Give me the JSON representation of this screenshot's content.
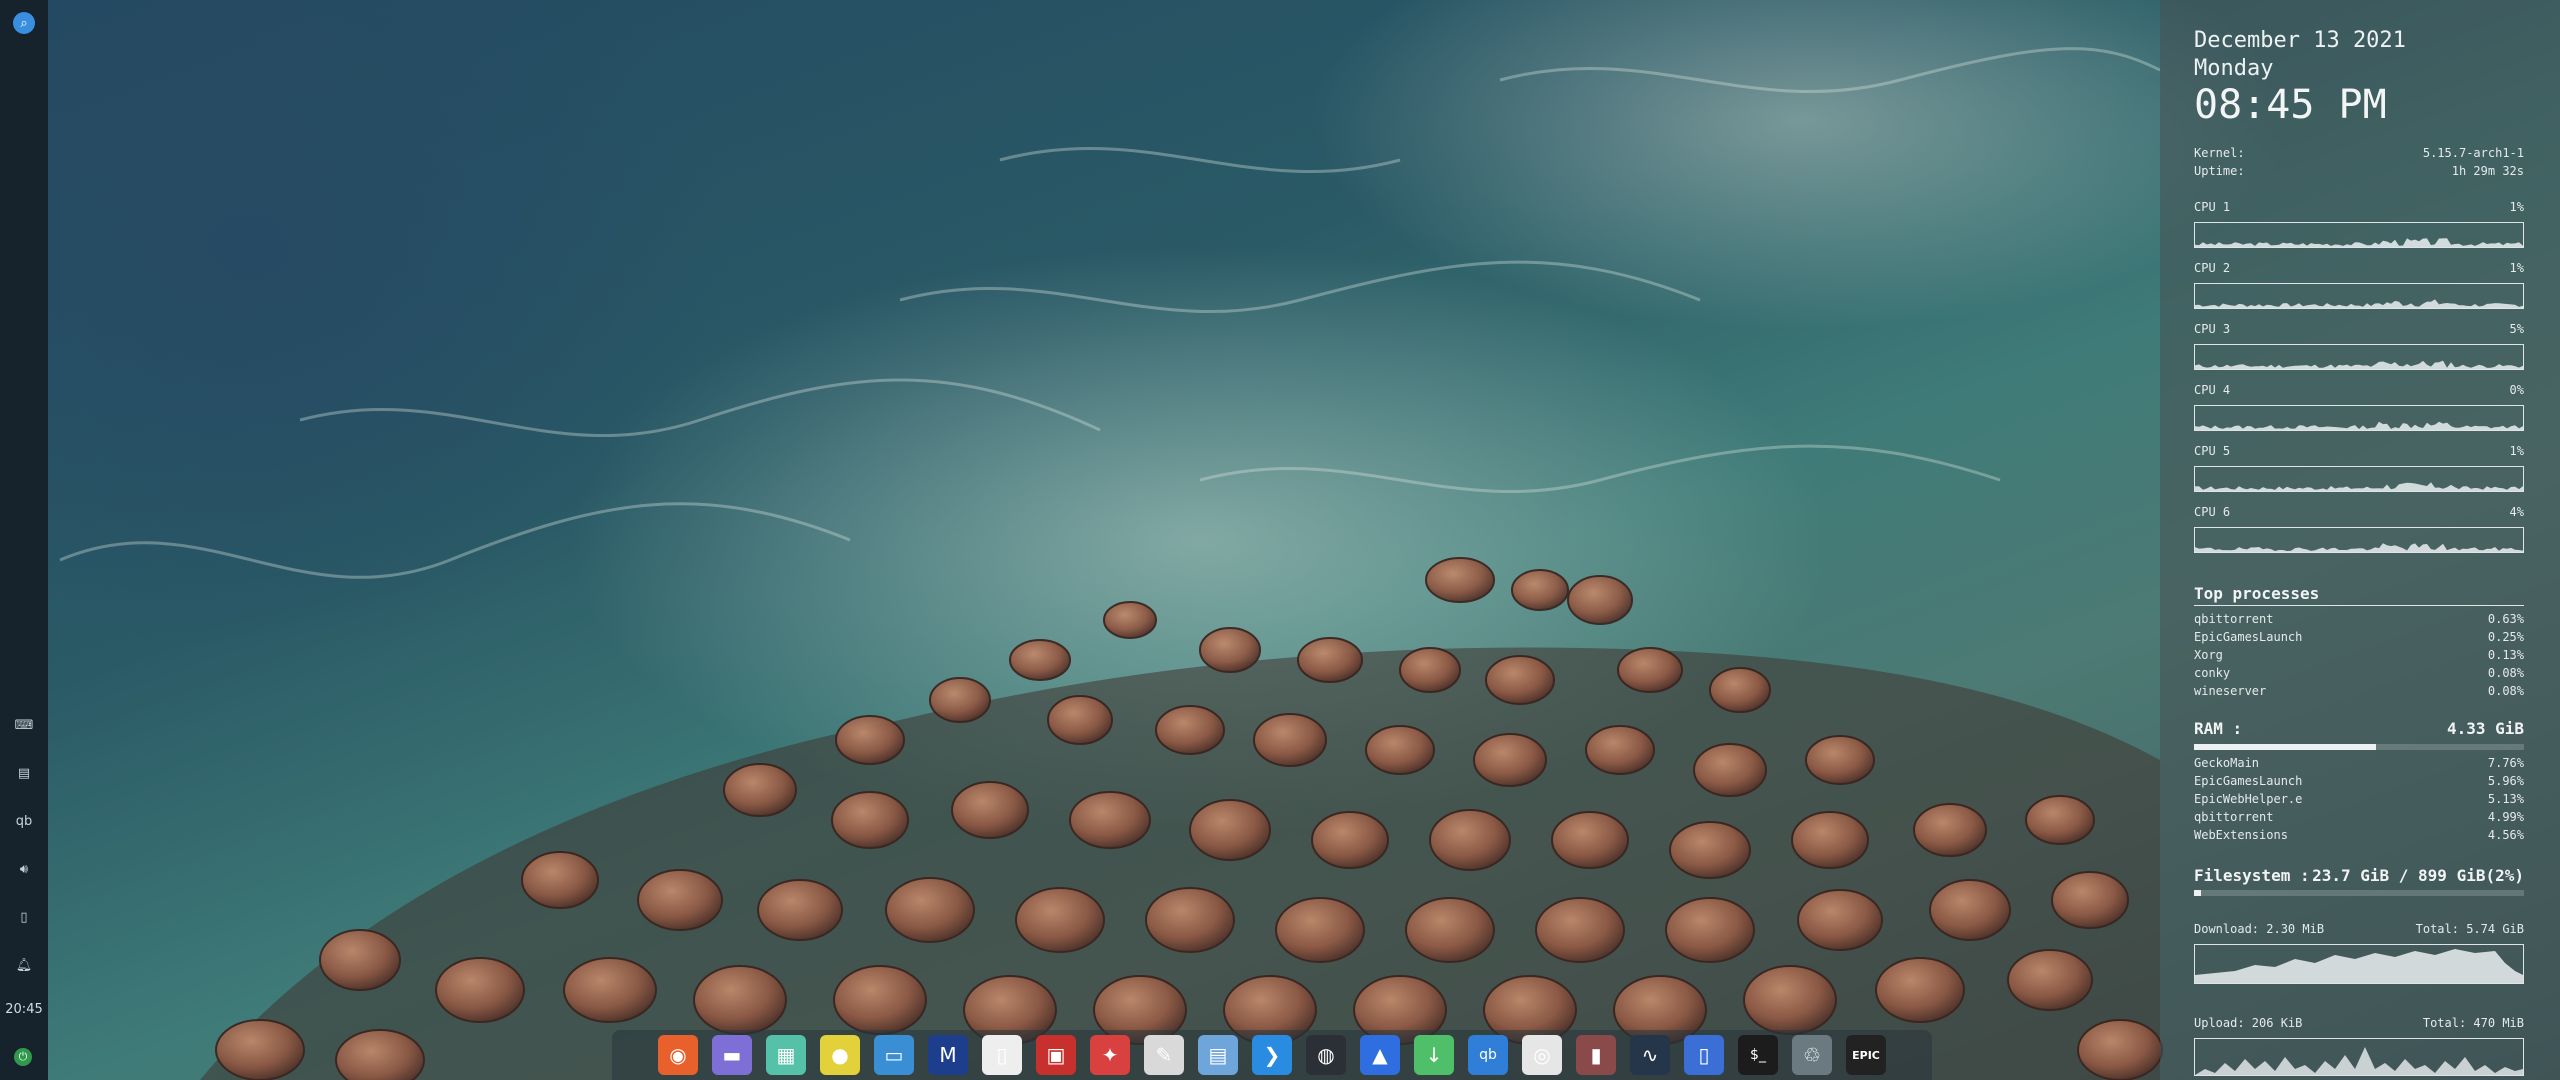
{
  "conky": {
    "date": "December 13 2021",
    "day": "Monday",
    "time": "08:45 PM",
    "kernel_label": "Kernel:",
    "kernel_value": "5.15.7-arch1-1",
    "uptime_label": "Uptime:",
    "uptime_value": "1h 29m 32s",
    "cpus": [
      {
        "label": "CPU 1",
        "value": "1%"
      },
      {
        "label": "CPU 2",
        "value": "1%"
      },
      {
        "label": "CPU 3",
        "value": "5%"
      },
      {
        "label": "CPU 4",
        "value": "0%"
      },
      {
        "label": "CPU 5",
        "value": "1%"
      },
      {
        "label": "CPU 6",
        "value": "4%"
      }
    ],
    "top_title": "Top processes",
    "top_processes": [
      {
        "name": "qbittorrent",
        "value": "0.63%"
      },
      {
        "name": "EpicGamesLaunch",
        "value": "0.25%"
      },
      {
        "name": "Xorg",
        "value": "0.13%"
      },
      {
        "name": "conky",
        "value": "0.08%"
      },
      {
        "name": "wineserver",
        "value": "0.08%"
      }
    ],
    "ram_label": "RAM :",
    "ram_value": "4.33 GiB",
    "ram_fraction": 0.55,
    "ram_processes": [
      {
        "name": "GeckoMain",
        "value": "7.76%"
      },
      {
        "name": "EpicGamesLaunch",
        "value": "5.96%"
      },
      {
        "name": "EpicWebHelper.e",
        "value": "5.13%"
      },
      {
        "name": "qbittorrent",
        "value": "4.99%"
      },
      {
        "name": "WebExtensions",
        "value": "4.56%"
      }
    ],
    "fs_label": "Filesystem :",
    "fs_value": "23.7 GiB / 899 GiB(2%)",
    "fs_fraction": 0.02,
    "download_label": "Download: 2.30 MiB",
    "download_total": "Total: 5.74 GiB",
    "upload_label": "Upload: 206 KiB",
    "upload_total": "Total: 470 MiB"
  },
  "left_panel": {
    "clock": "20:45",
    "top_icon": "search-icon",
    "tray_icons": [
      "keyboard-icon",
      "clipboard-icon",
      "qbittorrent-icon",
      "volume-icon",
      "battery-icon",
      "notification-icon"
    ],
    "bottom_icon": "power-icon"
  },
  "dock": {
    "apps": [
      {
        "name": "firefox-icon",
        "glyph": "◉",
        "color": "#e8602c"
      },
      {
        "name": "files-icon",
        "glyph": "▬",
        "color": "#7d6fd6"
      },
      {
        "name": "video-editor-icon",
        "glyph": "▦",
        "color": "#55c1a8"
      },
      {
        "name": "disc-icon",
        "glyph": "●",
        "color": "#e2d13a"
      },
      {
        "name": "screenshot-icon",
        "glyph": "▭",
        "color": "#3a8fd4"
      },
      {
        "name": "mail-icon",
        "glyph": "M",
        "color": "#1c3e8c"
      },
      {
        "name": "document-icon",
        "glyph": "▯",
        "color": "#eeeeee"
      },
      {
        "name": "ebook-icon",
        "glyph": "▣",
        "color": "#c8302d"
      },
      {
        "name": "pdf-icon",
        "glyph": "✦",
        "color": "#d94040"
      },
      {
        "name": "text-editor-icon",
        "glyph": "✎",
        "color": "#d9d9d9"
      },
      {
        "name": "window-icon",
        "glyph": "▤",
        "color": "#6ea6dc"
      },
      {
        "name": "vscode-icon",
        "glyph": "❯",
        "color": "#2a8ce0"
      },
      {
        "name": "steam-icon",
        "glyph": "◍",
        "color": "#2b2f36"
      },
      {
        "name": "store-icon",
        "glyph": "▲",
        "color": "#2f6ee0"
      },
      {
        "name": "download-icon",
        "glyph": "↓",
        "color": "#4fbf6a"
      },
      {
        "name": "qbittorrent-icon",
        "glyph": "qb",
        "color": "#2f7fd9"
      },
      {
        "name": "disk-burner-icon",
        "glyph": "◎",
        "color": "#e6e6e6"
      },
      {
        "name": "thermometer-icon",
        "glyph": "▮",
        "color": "#8a4a4a"
      },
      {
        "name": "system-monitor-icon",
        "glyph": "∿",
        "color": "#26364a"
      },
      {
        "name": "writer-icon",
        "glyph": "▯",
        "color": "#3b6fd6"
      },
      {
        "name": "terminal-icon",
        "glyph": "$_",
        "color": "#1c1c1c"
      },
      {
        "name": "trash-icon",
        "glyph": "♲",
        "color": "#6a7a80"
      },
      {
        "name": "epic-games-icon",
        "glyph": "EPIC",
        "color": "#222222"
      }
    ]
  }
}
